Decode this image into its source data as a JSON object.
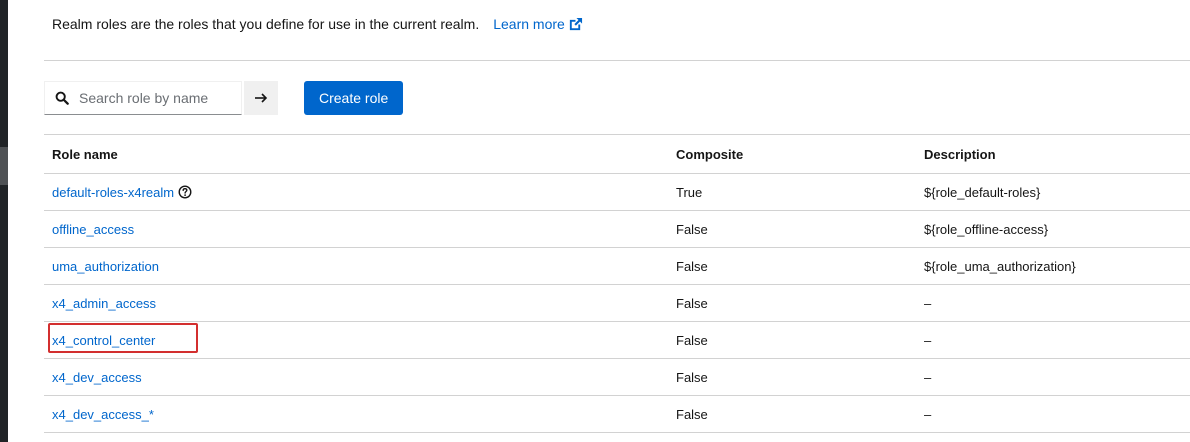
{
  "intro": {
    "text": "Realm roles are the roles that you define for use in the current realm.",
    "learn_more": "Learn more"
  },
  "toolbar": {
    "search_placeholder": "Search role by name",
    "create_label": "Create role"
  },
  "table": {
    "headers": {
      "name": "Role name",
      "composite": "Composite",
      "description": "Description"
    },
    "rows": [
      {
        "name": "default-roles-x4realm",
        "composite": "True",
        "description": "${role_default-roles}",
        "help": true
      },
      {
        "name": "offline_access",
        "composite": "False",
        "description": "${role_offline-access}"
      },
      {
        "name": "uma_authorization",
        "composite": "False",
        "description": "${role_uma_authorization}"
      },
      {
        "name": "x4_admin_access",
        "composite": "False",
        "description": "–"
      },
      {
        "name": "x4_control_center",
        "composite": "False",
        "description": "–",
        "highlighted": true
      },
      {
        "name": "x4_dev_access",
        "composite": "False",
        "description": "–"
      },
      {
        "name": "x4_dev_access_*",
        "composite": "False",
        "description": "–"
      }
    ]
  },
  "colors": {
    "link": "#0066cc",
    "primary_button": "#0066cc",
    "highlight_border": "#d32f2f",
    "sidebar": "#212427"
  },
  "icons": {
    "search": "search-icon",
    "arrow": "arrow-right-icon",
    "external": "external-link-icon",
    "help": "help-icon"
  }
}
